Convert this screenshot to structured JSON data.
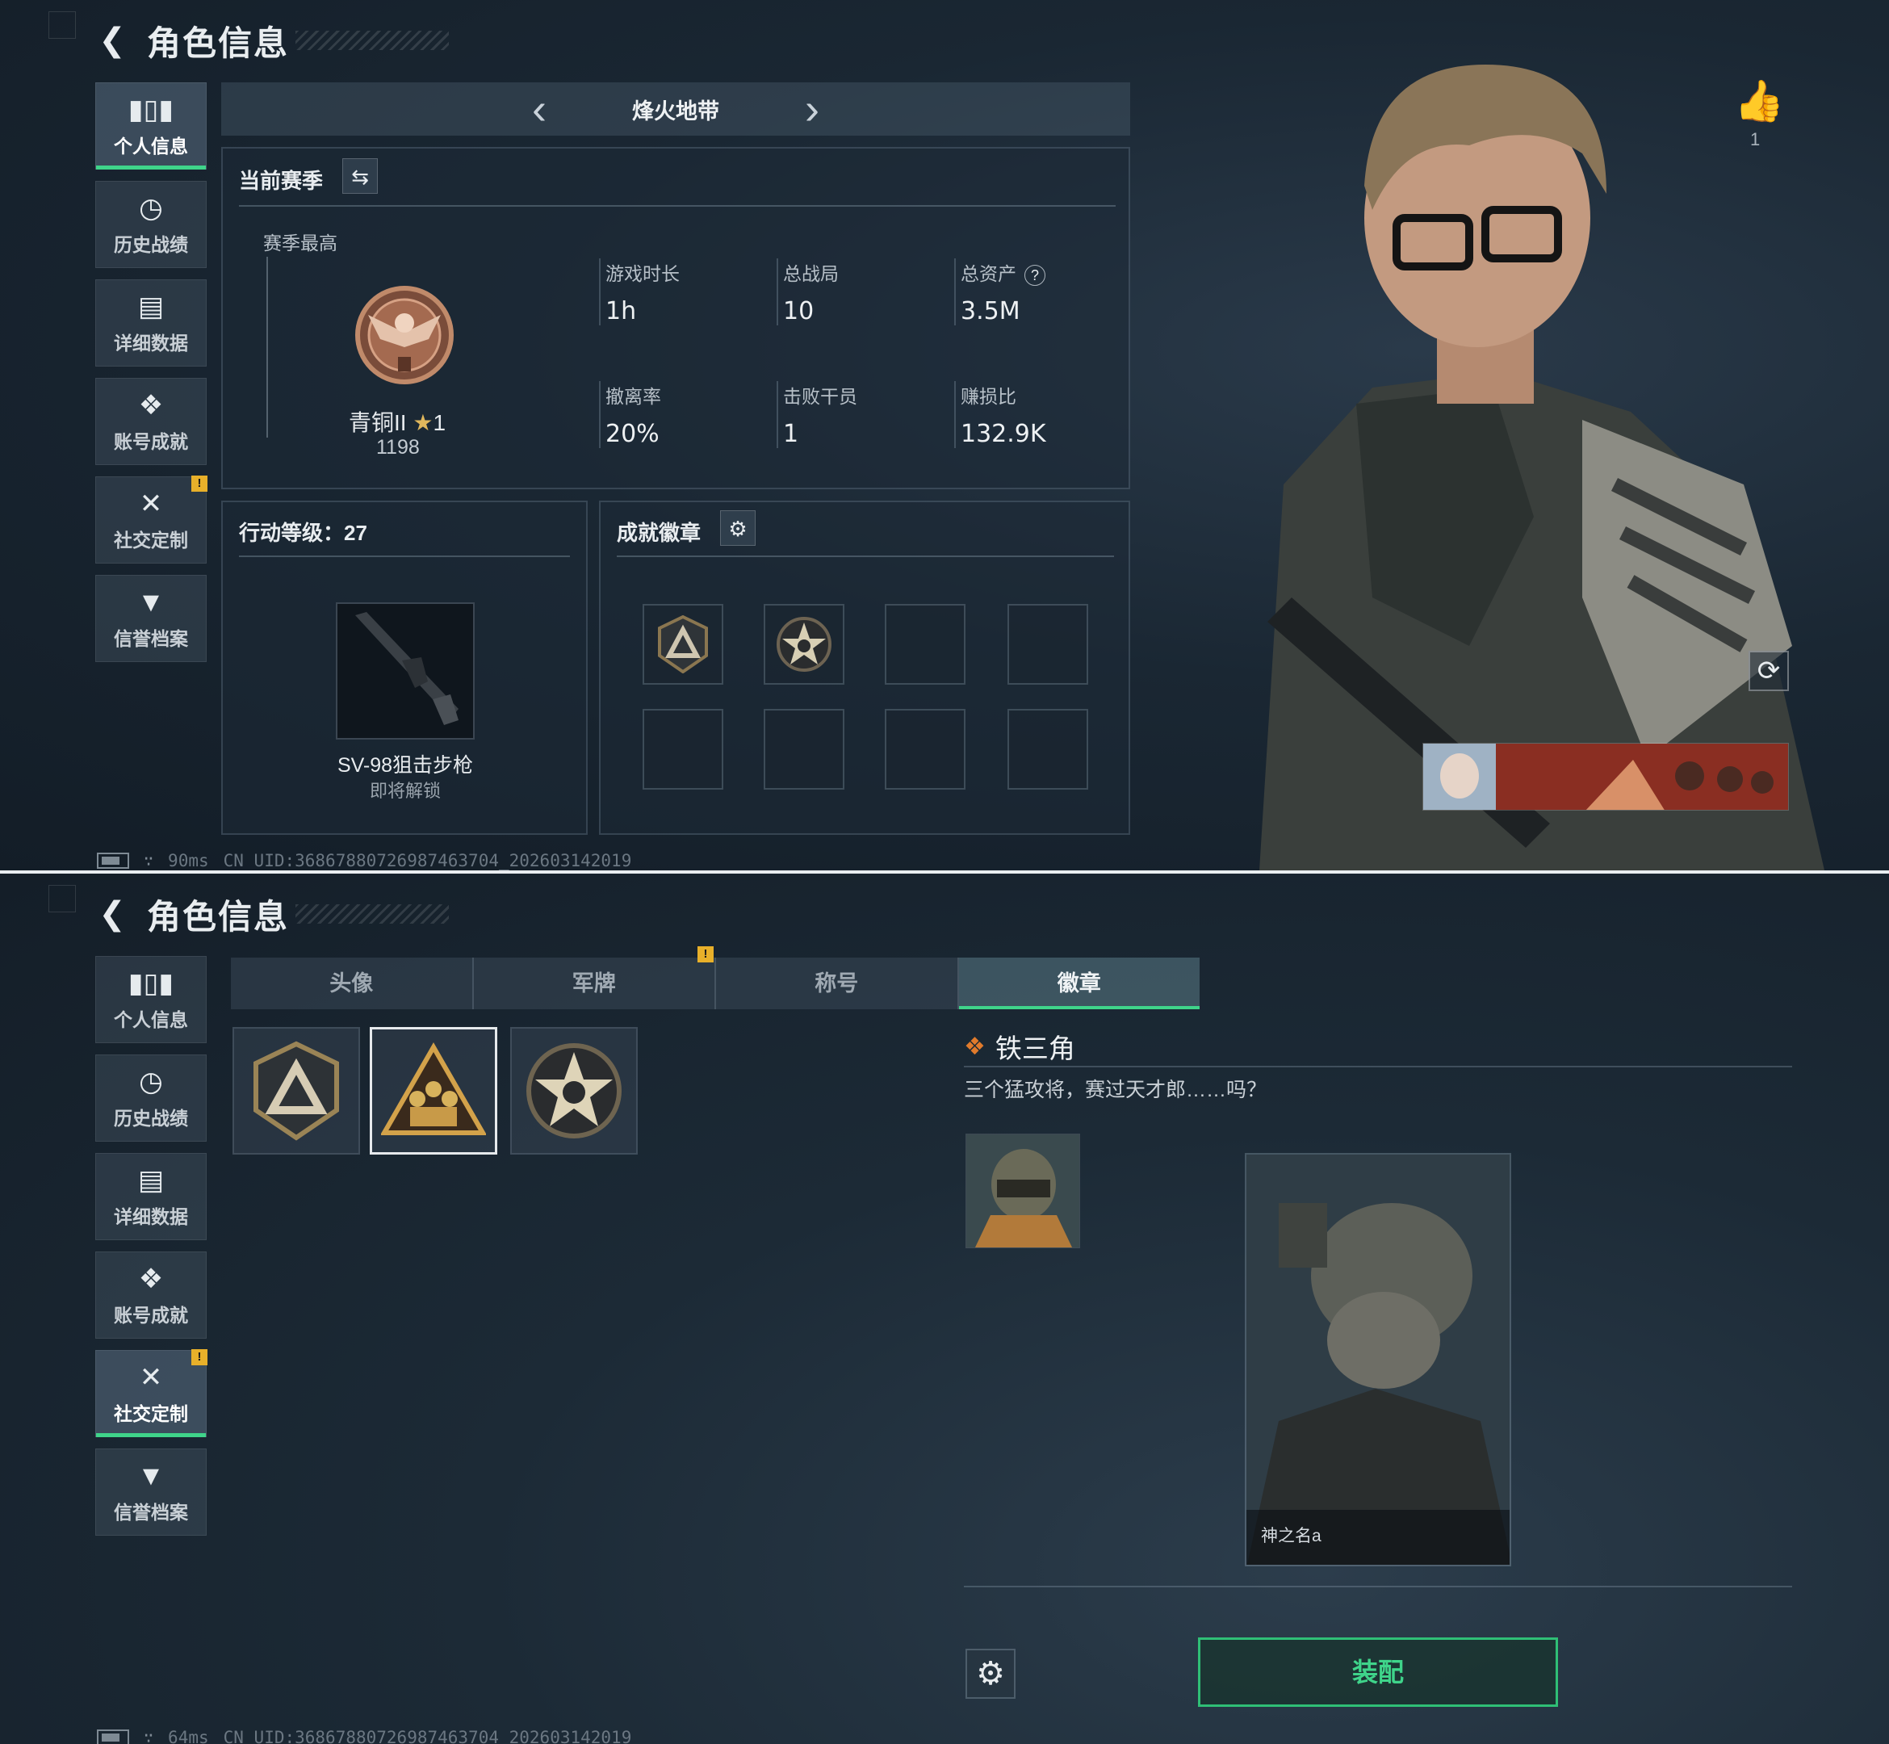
{
  "top": {
    "header": {
      "title": "角色信息"
    },
    "sidebar": {
      "items": [
        {
          "label": "个人信息",
          "icon": "bar-chart-icon",
          "active": true
        },
        {
          "label": "历史战绩",
          "icon": "clock-icon"
        },
        {
          "label": "详细数据",
          "icon": "folder-icon"
        },
        {
          "label": "账号成就",
          "icon": "achievement-icon"
        },
        {
          "label": "社交定制",
          "icon": "tools-icon",
          "warn": "!"
        },
        {
          "label": "信誉档案",
          "icon": "shield-icon"
        }
      ]
    },
    "season_bar": {
      "name": "烽火地带"
    },
    "season": {
      "title": "当前赛季",
      "best_label": "赛季最高",
      "rank_name": "青铜II",
      "rank_stars": "1",
      "rank_score": "1198",
      "stats": [
        {
          "label": "游戏时长",
          "value": "1h"
        },
        {
          "label": "总战局",
          "value": "10"
        },
        {
          "label": "总资产",
          "value": "3.5M",
          "help": "?"
        },
        {
          "label": "撤离率",
          "value": "20%"
        },
        {
          "label": "击败干员",
          "value": "1"
        },
        {
          "label": "赚损比",
          "value": "132.9K"
        }
      ]
    },
    "action": {
      "title": "行动等级：27",
      "weapon_name": "SV-98狙击步枪",
      "weapon_sub": "即将解锁"
    },
    "badges": {
      "title": "成就徽章"
    },
    "like_count": "1",
    "footer": {
      "ping": "90ms",
      "uid": "CN UID:3686788072698746370​4_202603142019"
    }
  },
  "bottom": {
    "header": {
      "title": "角色信息"
    },
    "sidebar": {
      "items": [
        {
          "label": "个人信息",
          "icon": "bar-chart-icon"
        },
        {
          "label": "历史战绩",
          "icon": "clock-icon"
        },
        {
          "label": "详细数据",
          "icon": "folder-icon"
        },
        {
          "label": "账号成就",
          "icon": "achievement-icon"
        },
        {
          "label": "社交定制",
          "icon": "tools-icon",
          "warn": "!",
          "active": true
        },
        {
          "label": "信誉档案",
          "icon": "shield-icon"
        }
      ]
    },
    "tabs": [
      {
        "label": "头像"
      },
      {
        "label": "军牌"
      },
      {
        "label": "称号"
      },
      {
        "label": "徽章",
        "active": true
      }
    ],
    "tab_warn": "!",
    "detail": {
      "title": "铁三角",
      "description": "三个猛攻将，赛过天才郎……吗？",
      "portrait_caption": "神之名a",
      "equip_label": "装配"
    },
    "footer": {
      "ping": "64ms",
      "uid": "CN UID:3686788072698746370​4_202603142019"
    }
  },
  "colors": {
    "accent": "#3fd48a",
    "warn": "#e8b02a",
    "bronze": "#b07a58"
  }
}
